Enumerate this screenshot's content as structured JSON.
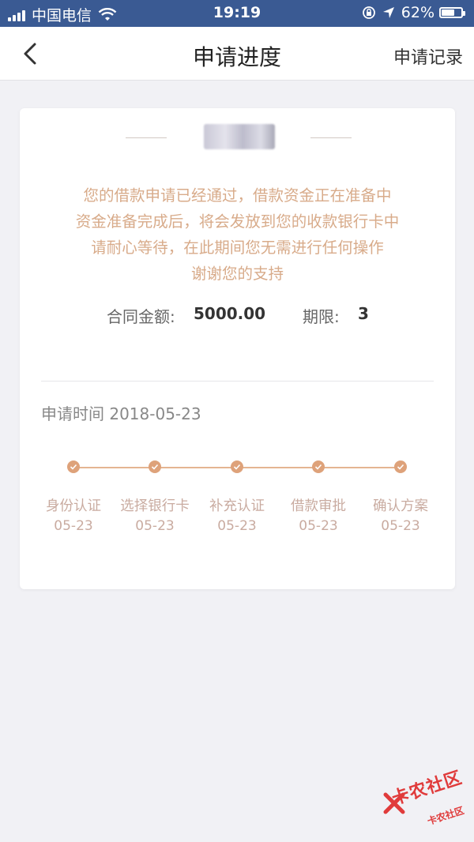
{
  "status_bar": {
    "carrier": "中国电信",
    "time": "19:19",
    "battery": "62%"
  },
  "nav": {
    "title": "申请进度",
    "right_label": "申请记录"
  },
  "card": {
    "message_lines": [
      "您的借款申请已经通过，借款资金正在准备中",
      "资金准备完成后，将会发放到您的收款银行卡中",
      "请耐心等待，在此期间您无需进行任何操作",
      "谢谢您的支持"
    ],
    "contract_amount_label": "合同金额:",
    "contract_amount_value": "5000.00",
    "term_label": "期限:",
    "term_value": "3",
    "apply_time": "申请时间 2018-05-23",
    "steps": [
      {
        "label": "身份认证",
        "date": "05-23"
      },
      {
        "label": "选择银行卡",
        "date": "05-23"
      },
      {
        "label": "补充认证",
        "date": "05-23"
      },
      {
        "label": "借款审批",
        "date": "05-23"
      },
      {
        "label": "确认方案",
        "date": "05-23"
      }
    ]
  },
  "watermark": {
    "main": "卡农社区",
    "sub": "卡农社区"
  },
  "colors": {
    "status_bar": "#3a5a93",
    "accent": "#dea27a",
    "message_text": "#d8ab8a"
  }
}
